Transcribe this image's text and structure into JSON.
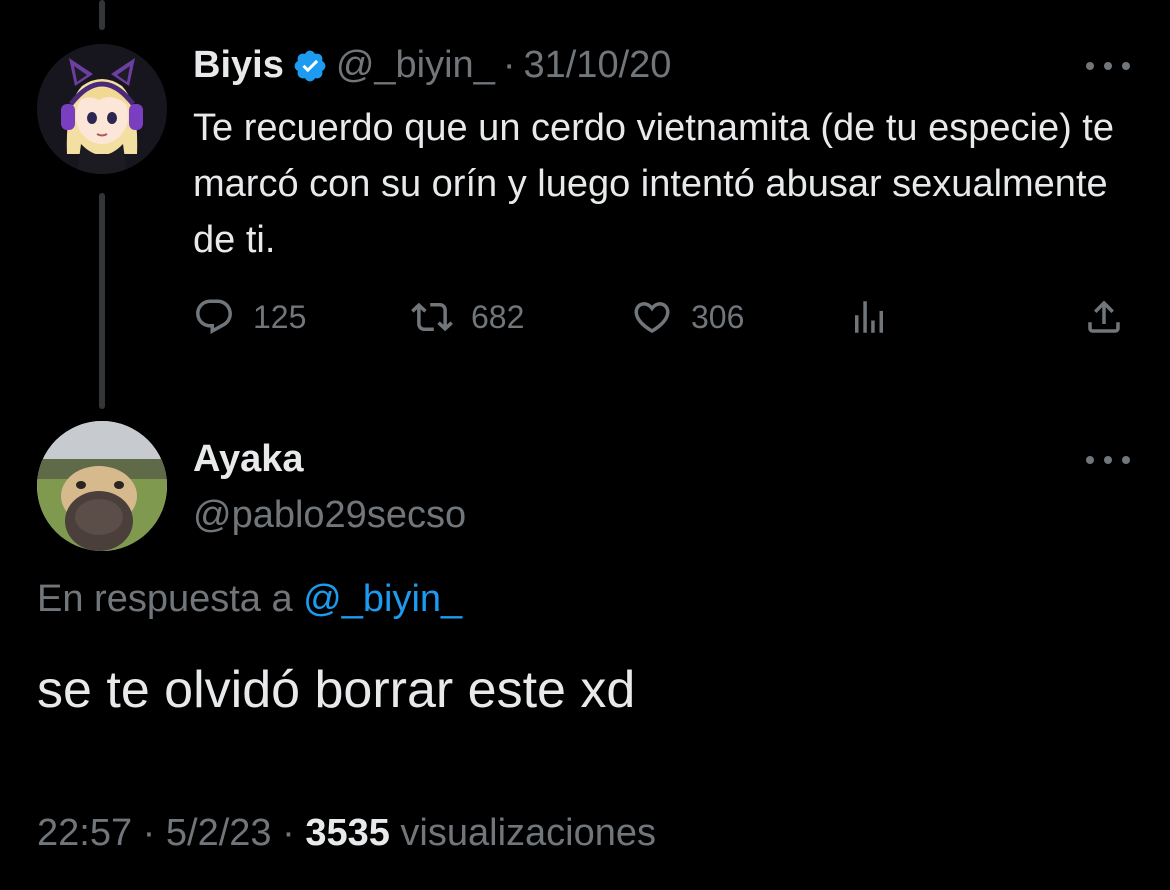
{
  "parent_tweet": {
    "display_name": "Biyis",
    "handle": "@_biyin_",
    "separator": "·",
    "date": "31/10/20",
    "text": "Te recuerdo que un cerdo vietnamita (de tu especie) te marcó con su orín y luego intentó abusar sexualmente de ti.",
    "actions": {
      "reply_count": "125",
      "retweet_count": "682",
      "like_count": "306"
    },
    "icons": [
      "verified-badge-icon",
      "reply-icon",
      "retweet-icon",
      "like-icon",
      "views-icon",
      "share-icon",
      "more-icon"
    ]
  },
  "reply_tweet": {
    "display_name": "Ayaka",
    "handle": "@pablo29secso",
    "in_reply_prefix": "En respuesta a",
    "in_reply_handle": "@_biyin_",
    "text": "se te olvidó borrar este xd",
    "time": "22:57",
    "date": "5/2/23",
    "separator": "·",
    "views_count": "3535",
    "views_label": "visualizaciones"
  },
  "colors": {
    "background": "#000000",
    "text": "#e7e9ea",
    "muted": "#71767b",
    "link": "#1d9bf0",
    "verified": "#1d9bf0",
    "thread_line": "#333639"
  }
}
